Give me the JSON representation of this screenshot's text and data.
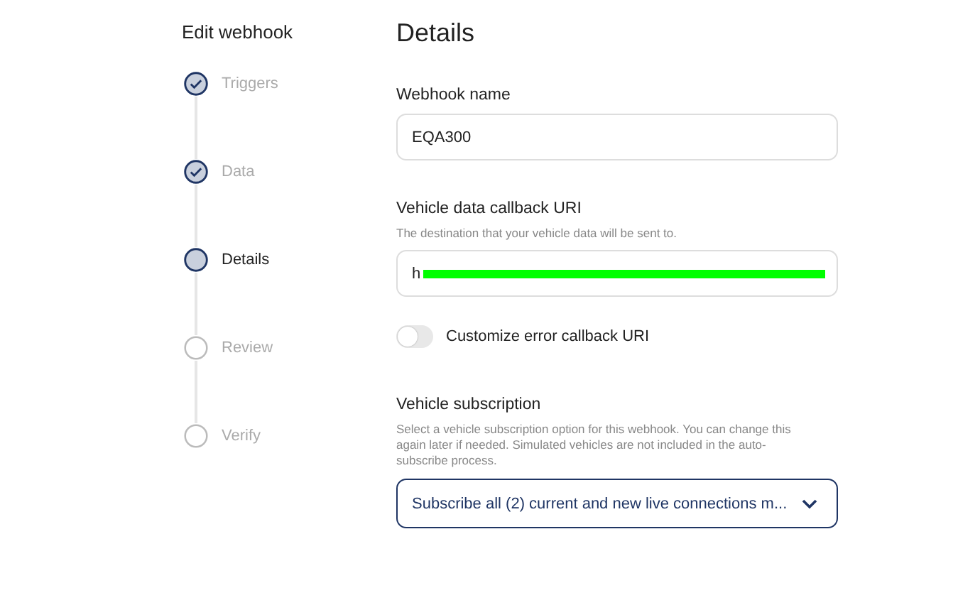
{
  "sidebar": {
    "title": "Edit webhook",
    "steps": [
      {
        "label": "Triggers",
        "kind": "done"
      },
      {
        "label": "Data",
        "kind": "done"
      },
      {
        "label": "Details",
        "kind": "current"
      },
      {
        "label": "Review",
        "kind": "pending"
      },
      {
        "label": "Verify",
        "kind": "pending"
      }
    ]
  },
  "main": {
    "title": "Details",
    "webhook_name": {
      "label": "Webhook name",
      "value": "EQA300"
    },
    "callback_uri": {
      "label": "Vehicle data callback URI",
      "hint": "The destination that your vehicle data will be sent to.",
      "value": "h",
      "redacted": true
    },
    "error_callback": {
      "label": "Customize error callback URI",
      "on": false
    },
    "subscription": {
      "label": "Vehicle subscription",
      "hint": "Select a vehicle subscription option for this webhook. You can change this again later if needed. Simulated vehicles are not included in the auto-subscribe process.",
      "value": "Subscribe all (2) current and new live connections m..."
    }
  }
}
